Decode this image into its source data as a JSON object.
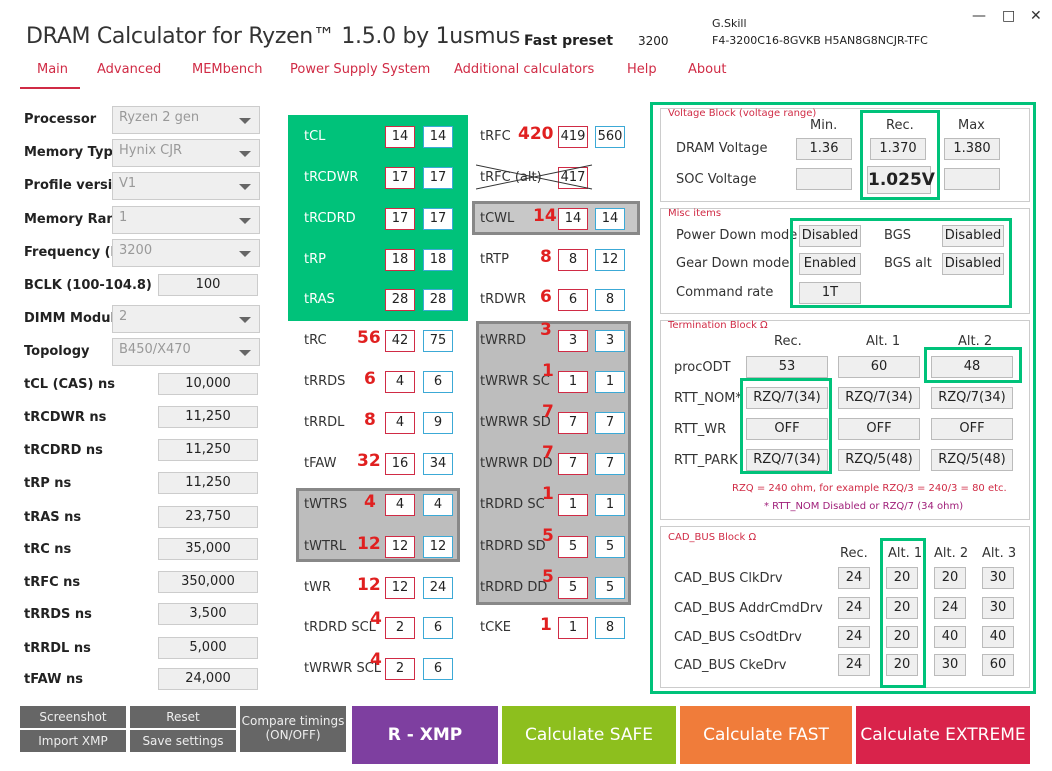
{
  "app": {
    "title": "DRAM Calculator for Ryzen™ 1.5.0 by 1usmus",
    "preset": "Fast preset",
    "frequency": "3200",
    "memory_vendor": "G.Skill",
    "memory_part": "F4-3200C16-8GVKB  H5AN8G8NCJR-TFC"
  },
  "window": {
    "minimize": "—",
    "maximize": "□",
    "close": "✕"
  },
  "nav": [
    "Main",
    "Advanced",
    "MEMbench",
    "Power Supply System",
    "Additional calculators",
    "Help",
    "About"
  ],
  "settings": [
    {
      "label": "Processor",
      "value": "Ryzen 2 gen",
      "kind": "select"
    },
    {
      "label": "Memory Type",
      "value": "Hynix CJR",
      "kind": "select"
    },
    {
      "label": "Profile version",
      "value": "V1",
      "kind": "select"
    },
    {
      "label": "Memory Rank",
      "value": "1",
      "kind": "select"
    },
    {
      "label": "Frequency (MT/s)",
      "value": "3200",
      "kind": "select"
    },
    {
      "label": "BCLK (100-104.8)",
      "value": "100",
      "kind": "input"
    },
    {
      "label": "DIMM Modules",
      "value": "2",
      "kind": "select"
    },
    {
      "label": "Topology",
      "value": "B450/X470",
      "kind": "select"
    },
    {
      "label": "tCL (CAS) ns",
      "value": "10,000",
      "kind": "input"
    },
    {
      "label": "tRCDWR ns",
      "value": "11,250",
      "kind": "input"
    },
    {
      "label": "tRCDRD ns",
      "value": "11,250",
      "kind": "input"
    },
    {
      "label": "tRP ns",
      "value": "11,250",
      "kind": "input"
    },
    {
      "label": "tRAS ns",
      "value": "23,750",
      "kind": "input"
    },
    {
      "label": "tRC ns",
      "value": "35,000",
      "kind": "input"
    },
    {
      "label": "tRFC ns",
      "value": "350,000",
      "kind": "input"
    },
    {
      "label": "tRRDS ns",
      "value": "3,500",
      "kind": "input"
    },
    {
      "label": "tRRDL ns",
      "value": "5,000",
      "kind": "input"
    },
    {
      "label": "tFAW ns",
      "value": "24,000",
      "kind": "input"
    }
  ],
  "timings_col1": [
    {
      "name": "tCL",
      "rec": "",
      "a": "14",
      "b": "14"
    },
    {
      "name": "tRCDWR",
      "rec": "",
      "a": "17",
      "b": "17"
    },
    {
      "name": "tRCDRD",
      "rec": "",
      "a": "17",
      "b": "17"
    },
    {
      "name": "tRP",
      "rec": "",
      "a": "18",
      "b": "18"
    },
    {
      "name": "tRAS",
      "rec": "",
      "a": "28",
      "b": "28"
    },
    {
      "name": "tRC",
      "rec": "56",
      "a": "42",
      "b": "75"
    },
    {
      "name": "tRRDS",
      "rec": "6",
      "a": "4",
      "b": "6"
    },
    {
      "name": "tRRDL",
      "rec": "8",
      "a": "4",
      "b": "9"
    },
    {
      "name": "tFAW",
      "rec": "32",
      "a": "16",
      "b": "34"
    },
    {
      "name": "tWTRS",
      "rec": "4",
      "a": "4",
      "b": "4"
    },
    {
      "name": "tWTRL",
      "rec": "12",
      "a": "12",
      "b": "12"
    },
    {
      "name": "tWR",
      "rec": "12",
      "a": "12",
      "b": "24"
    },
    {
      "name": "tRDRD SCL",
      "rec": "4",
      "a": "2",
      "b": "6"
    },
    {
      "name": "tWRWR SCL",
      "rec": "4",
      "a": "2",
      "b": "6"
    }
  ],
  "timings_col2": [
    {
      "name": "tRFC",
      "rec": "420",
      "a": "419",
      "b": "560"
    },
    {
      "name": "tRFC (alt)",
      "rec": "",
      "a": "417",
      "b": ""
    },
    {
      "name": "tCWL",
      "rec": "14",
      "a": "14",
      "b": "14"
    },
    {
      "name": "tRTP",
      "rec": "8",
      "a": "8",
      "b": "12"
    },
    {
      "name": "tRDWR",
      "rec": "6",
      "a": "6",
      "b": "8"
    },
    {
      "name": "tWRRD",
      "rec": "3",
      "a": "3",
      "b": "3"
    },
    {
      "name": "tWRWR SC",
      "rec": "1",
      "a": "1",
      "b": "1"
    },
    {
      "name": "tWRWR SD",
      "rec": "7",
      "a": "7",
      "b": "7"
    },
    {
      "name": "tWRWR DD",
      "rec": "7",
      "a": "7",
      "b": "7"
    },
    {
      "name": "tRDRD SC",
      "rec": "1",
      "a": "1",
      "b": "1"
    },
    {
      "name": "tRDRD SD",
      "rec": "5",
      "a": "5",
      "b": "5"
    },
    {
      "name": "tRDRD DD",
      "rec": "5",
      "a": "5",
      "b": "5"
    },
    {
      "name": "tCKE",
      "rec": "1",
      "a": "1",
      "b": "8"
    }
  ],
  "voltage": {
    "title": "Voltage Block (voltage range)",
    "col_min": "Min.",
    "col_rec": "Rec.",
    "col_max": "Max",
    "dram_label": "DRAM Voltage",
    "dram_min": "1.36",
    "dram_rec": "1.370",
    "dram_max": "1.380",
    "soc_label": "SOC Voltage",
    "soc_min": "",
    "soc_rec": "1.025V",
    "soc_max": ""
  },
  "misc": {
    "title": "Misc items",
    "power_down_label": "Power Down mode",
    "power_down": "Disabled",
    "bgs_label": "BGS",
    "bgs": "Disabled",
    "gear_down_label": "Gear Down mode",
    "gear_down": "Enabled",
    "bgs_alt_label": "BGS alt",
    "bgs_alt": "Disabled",
    "cmd_rate_label": "Command rate",
    "cmd_rate": "1T"
  },
  "termination": {
    "title": "Termination Block Ω",
    "col_rec": "Rec.",
    "col_alt1": "Alt. 1",
    "col_alt2": "Alt. 2",
    "rows": [
      {
        "label": "procODT",
        "rec": "53",
        "alt1": "60",
        "alt2": "48"
      },
      {
        "label": "RTT_NOM*",
        "rec": "RZQ/7(34)",
        "alt1": "RZQ/7(34)",
        "alt2": "RZQ/7(34)"
      },
      {
        "label": "RTT_WR",
        "rec": "OFF",
        "alt1": "OFF",
        "alt2": "OFF"
      },
      {
        "label": "RTT_PARK",
        "rec": "RZQ/7(34)",
        "alt1": "RZQ/5(48)",
        "alt2": "RZQ/5(48)"
      }
    ],
    "note1": "RZQ = 240 ohm, for example RZQ/3 = 240/3 = 80 etc.",
    "note2": "* RTT_NOM Disabled or RZQ/7 (34 ohm)"
  },
  "cad": {
    "title": "CAD_BUS Block Ω",
    "col_rec": "Rec.",
    "col_alt1": "Alt. 1",
    "col_alt2": "Alt. 2",
    "col_alt3": "Alt. 3",
    "rows": [
      {
        "label": "CAD_BUS ClkDrv",
        "rec": "24",
        "alt1": "20",
        "alt2": "20",
        "alt3": "30"
      },
      {
        "label": "CAD_BUS AddrCmdDrv",
        "rec": "24",
        "alt1": "20",
        "alt2": "24",
        "alt3": "30"
      },
      {
        "label": "CAD_BUS CsOdtDrv",
        "rec": "24",
        "alt1": "20",
        "alt2": "40",
        "alt3": "40"
      },
      {
        "label": "CAD_BUS CkeDrv",
        "rec": "24",
        "alt1": "20",
        "alt2": "30",
        "alt3": "60"
      }
    ]
  },
  "buttons": {
    "screenshot": "Screenshot",
    "reset": "Reset",
    "import_xmp": "Import XMP",
    "save_settings": "Save settings",
    "compare_1": "Compare timings",
    "compare_2": "(ON/OFF)",
    "rxmp": "R - XMP",
    "safe": "Calculate SAFE",
    "fast": "Calculate FAST",
    "extreme": "Calculate EXTREME"
  },
  "colors": {
    "accent": "#d02b45",
    "highlight_green": "#00c27a",
    "rxmp": "#7e3fa0",
    "safe": "#8dbf1e",
    "fast": "#f07c3a",
    "extreme": "#d9234b"
  }
}
